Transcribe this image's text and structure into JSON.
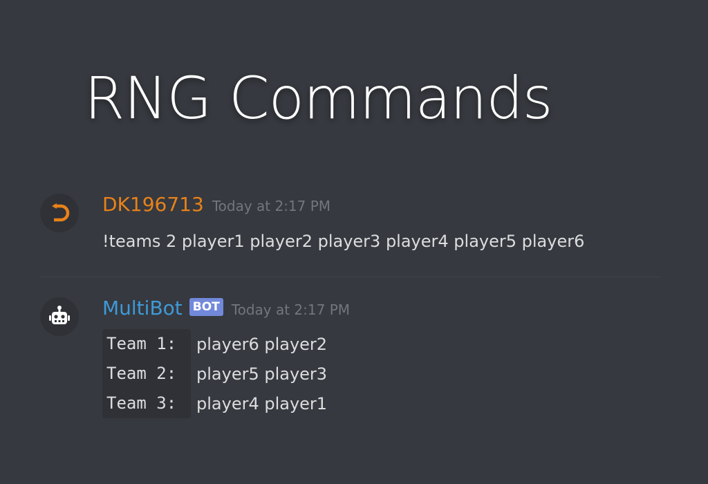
{
  "title": "RNG Commands",
  "messages": [
    {
      "username": "DK196713",
      "timestamp": "Today at 2:17 PM",
      "content": "!teams 2 player1 player2 player3 player4 player5 player6",
      "avatar_icon": "discord-logo-icon",
      "name_color": "#e8821a"
    },
    {
      "username": "MultiBot",
      "badge": "BOT",
      "timestamp": "Today at 2:17 PM",
      "avatar_icon": "robot-icon",
      "name_color": "#3f9ad8",
      "teams": [
        {
          "label": "Team 1:",
          "players": "player6 player2"
        },
        {
          "label": "Team 2:",
          "players": "player5 player3"
        },
        {
          "label": "Team 3:",
          "players": "player4 player1"
        }
      ]
    }
  ],
  "colors": {
    "background": "#36393f",
    "code_background": "#2f3136",
    "badge": "#7289da",
    "timestamp": "#72767d"
  }
}
